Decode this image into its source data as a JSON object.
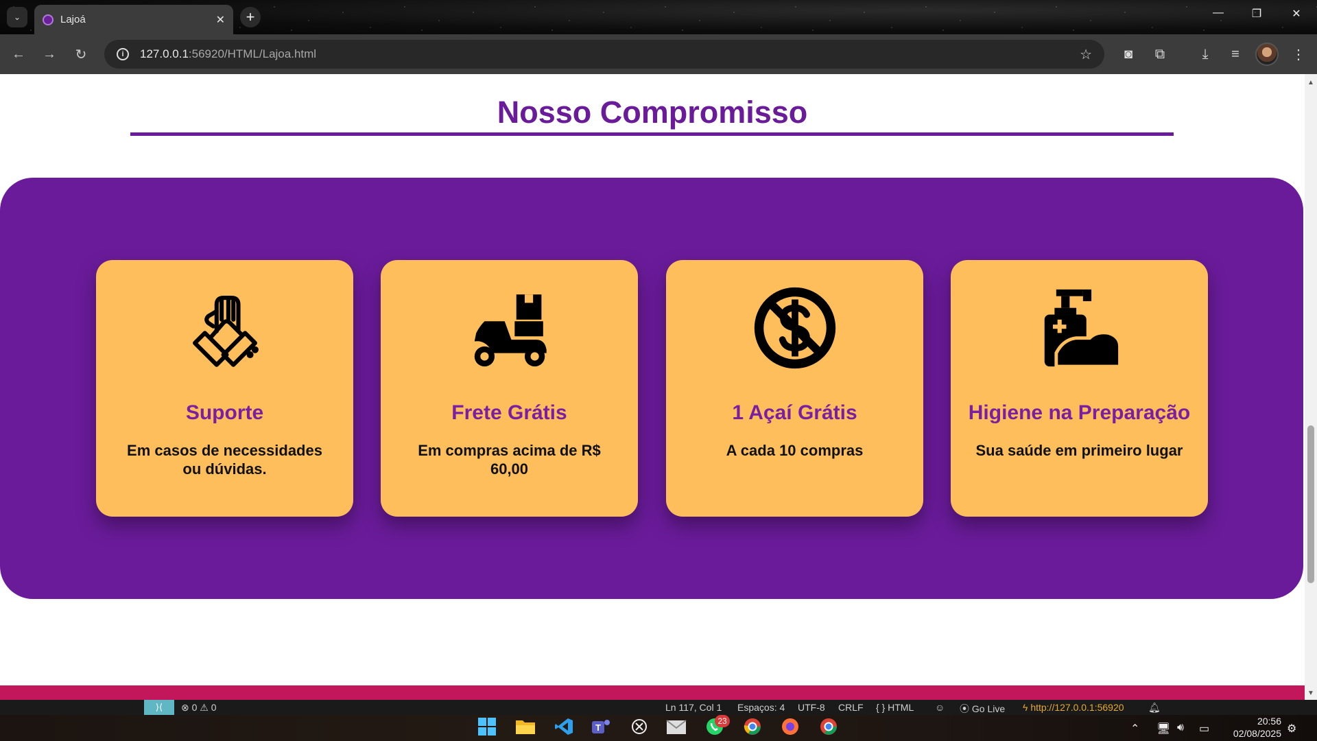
{
  "browser": {
    "tab": {
      "title": "Lajoá"
    },
    "url": {
      "host": "127.0.0.1",
      "path": ":56920/HTML/Lajoa.html"
    }
  },
  "page": {
    "section_title": "Nosso Compromisso",
    "cards": [
      {
        "title": "Suporte",
        "text": "Em casos de necessidades ou dúvidas.",
        "icon": "handshake-icon"
      },
      {
        "title": "Frete Grátis",
        "text": "Em compras acima de R$ 60,00",
        "icon": "delivery-scooter-icon"
      },
      {
        "title": "1 Açaí Grátis",
        "text": "A cada 10 compras",
        "icon": "no-dollar-icon"
      },
      {
        "title": "Higiene na Preparação",
        "text": "Sua saúde em primeiro lugar",
        "icon": "hand-sanitizer-icon"
      }
    ],
    "colors": {
      "title": "#6a1b9a",
      "panel": "#6a1b9a",
      "card": "#ffbe5c",
      "card_title": "#7b1fa2",
      "footer": "#c2185b"
    }
  },
  "vscode_status": {
    "problems": "⊗ 0 ⚠ 0",
    "position": "Ln 117, Col 1",
    "spaces": "Espaços: 4",
    "encoding": "UTF-8",
    "eol": "CRLF",
    "language": "{ } HTML",
    "go_live": "Go Live",
    "server": "http://127.0.0.1:56920"
  },
  "taskbar": {
    "whatsapp_badge": "23",
    "time": "20:56",
    "date": "02/08/2025"
  }
}
